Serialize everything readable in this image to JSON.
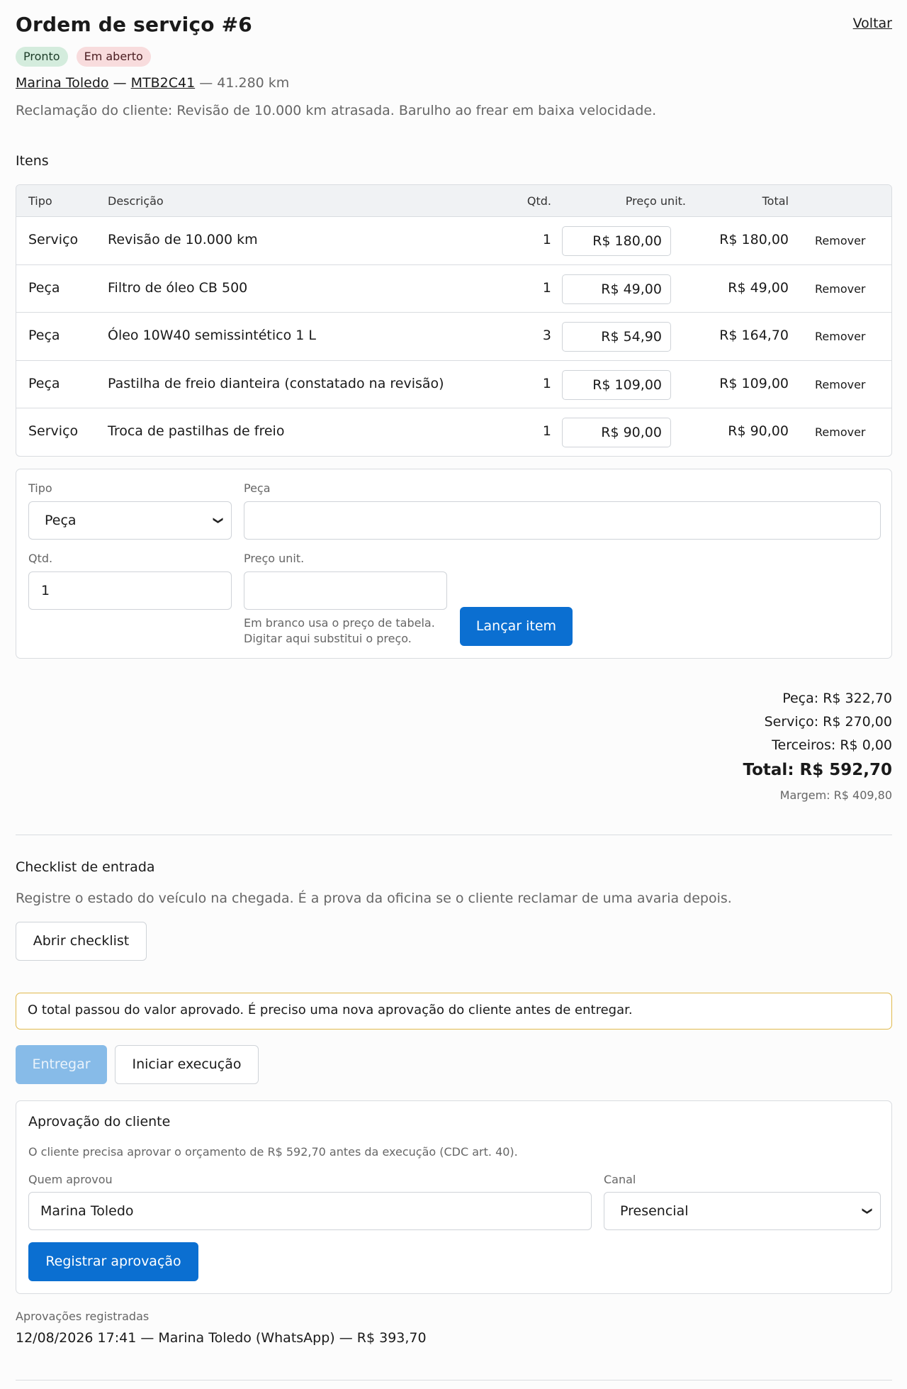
{
  "header": {
    "title": "Ordem de serviço #6",
    "back_label": "Voltar"
  },
  "badges": {
    "status": "Pronto",
    "payment": "Em aberto"
  },
  "vehicle": {
    "customer": "Marina Toledo",
    "sep1": "—",
    "plate": "MTB2C41",
    "mileage": "— 41.280 km"
  },
  "complaint": "Reclamação do cliente: Revisão de 10.000 km atrasada. Barulho ao frear em baixa velocidade.",
  "items": {
    "title": "Itens",
    "headers": {
      "type": "Tipo",
      "description": "Descrição",
      "qty": "Qtd.",
      "unit_price": "Preço unit.",
      "total": "Total"
    },
    "rows": [
      {
        "type": "Serviço",
        "description": "Revisão de 10.000 km",
        "qty": "1",
        "unit_price": "R$ 180,00",
        "total": "R$ 180,00",
        "action": "Remover"
      },
      {
        "type": "Peça",
        "description": "Filtro de óleo CB 500",
        "qty": "1",
        "unit_price": "R$ 49,00",
        "total": "R$ 49,00",
        "action": "Remover"
      },
      {
        "type": "Peça",
        "description": "Óleo 10W40 semissintético 1 L",
        "qty": "3",
        "unit_price": "R$ 54,90",
        "total": "R$ 164,70",
        "action": "Remover"
      },
      {
        "type": "Peça",
        "description": "Pastilha de freio dianteira (constatado na revisão)",
        "qty": "1",
        "unit_price": "R$ 109,00",
        "total": "R$ 109,00",
        "action": "Remover"
      },
      {
        "type": "Serviço",
        "description": "Troca de pastilhas de freio",
        "qty": "1",
        "unit_price": "R$ 90,00",
        "total": "R$ 90,00",
        "action": "Remover"
      }
    ]
  },
  "add_item": {
    "type_label": "Tipo",
    "type_value": "Peça",
    "part_label": "Peça",
    "part_value": "",
    "qty_label": "Qtd.",
    "qty_value": "1",
    "price_label": "Preço unit.",
    "price_value": "",
    "hint_line1": "Em branco usa o preço de tabela.",
    "hint_line2": "Digitar aqui substitui o preço.",
    "submit_label": "Lançar item"
  },
  "summary": {
    "parts": "Peça: R$ 322,70",
    "services": "Serviço: R$ 270,00",
    "third_party": "Terceiros: R$ 0,00",
    "total": "Total: R$ 592,70",
    "margin": "Margem: R$ 409,80"
  },
  "checklist": {
    "title": "Checklist de entrada",
    "description": "Registre o estado do veículo na chegada. É a prova da oficina se o cliente reclamar de uma avaria depois.",
    "button_label": "Abrir checklist"
  },
  "warning": "O total passou do valor aprovado. É preciso uma nova aprovação do cliente antes de entregar.",
  "actions": {
    "deliver_label": "Entregar",
    "start_label": "Iniciar execução"
  },
  "approval": {
    "title": "Aprovação do cliente",
    "description": "O cliente precisa aprovar o orçamento de R$ 592,70 antes da execução (CDC art. 40).",
    "approver_label": "Quem aprovou",
    "approver_value": "Marina Toledo",
    "channel_label": "Canal",
    "channel_value": "Presencial",
    "submit_label": "Registrar aprovação"
  },
  "registered": {
    "label": "Aprovações registradas",
    "entries": [
      "12/08/2026 17:41 — Marina Toledo (WhatsApp) — R$ 393,70"
    ]
  },
  "colors": {
    "primary": "#0b6fd1",
    "primary_disabled": "#87bbe8",
    "badge_ready_bg": "#d4ecdd",
    "badge_open_bg": "#f8dcdd",
    "warning_border": "#e0b94c"
  }
}
